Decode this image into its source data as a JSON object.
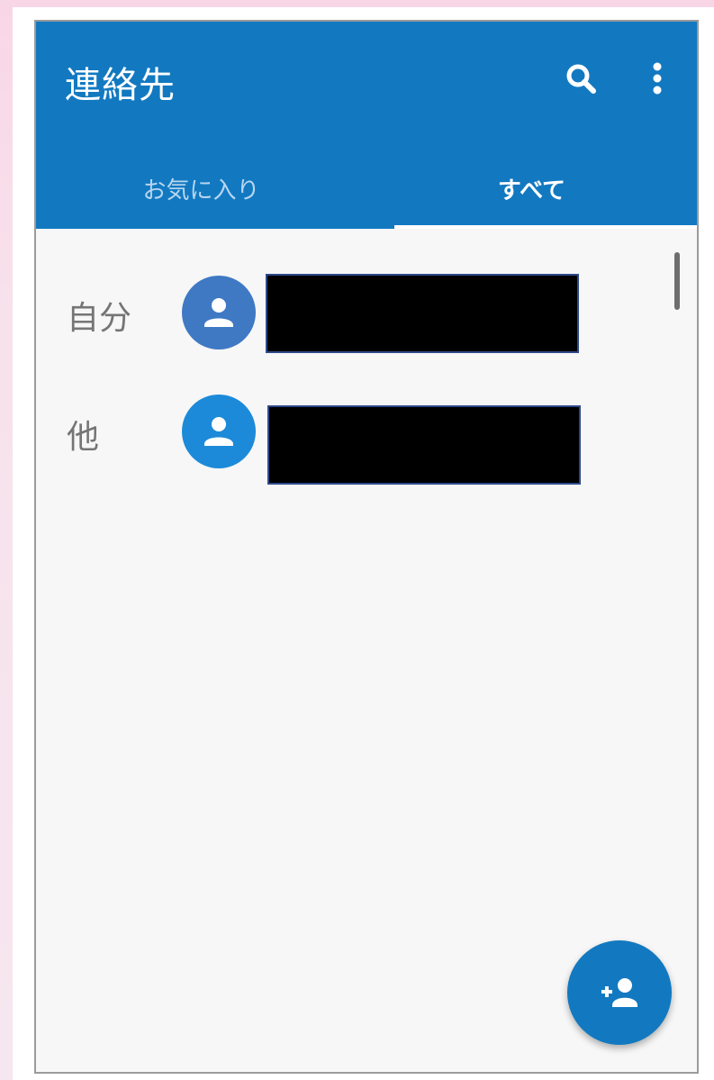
{
  "appbar": {
    "title": "連絡先",
    "search_icon": "search-icon",
    "more_icon": "more-vert-icon",
    "color": "#1279c1"
  },
  "tabs": [
    {
      "label": "お気に入り",
      "selected": false
    },
    {
      "label": "すべて",
      "selected": true
    }
  ],
  "contacts": {
    "sections": [
      {
        "label": "自分",
        "avatar_icon": "person-icon",
        "avatar_color": "#3f79c4",
        "name": "",
        "name_redacted": true
      },
      {
        "label": "他",
        "avatar_icon": "person-icon",
        "avatar_color": "#1c8ad9",
        "name": "",
        "name_redacted": true
      }
    ]
  },
  "fab": {
    "icon": "add-person-icon",
    "color": "#1279c1"
  }
}
